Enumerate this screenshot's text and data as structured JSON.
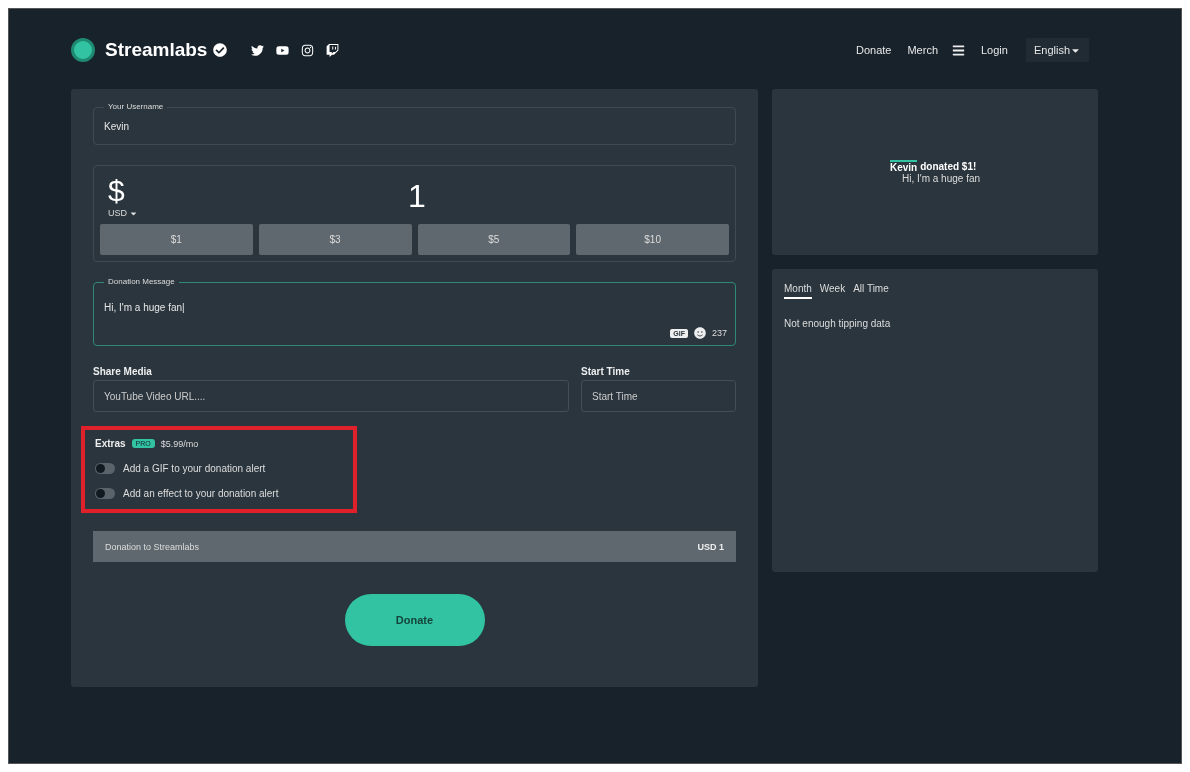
{
  "header": {
    "brand": "Streamlabs",
    "nav": [
      "Donate",
      "Merch"
    ],
    "login": "Login",
    "language": "English"
  },
  "form": {
    "username": {
      "label": "Your Username",
      "value": "Kevin"
    },
    "amount": {
      "symbol": "$",
      "currency": "USD",
      "value": "1",
      "presets": [
        "$1",
        "$3",
        "$5",
        "$10"
      ]
    },
    "message": {
      "label": "Donation Message",
      "value": "Hi, I'm a huge fan|",
      "gif": "GIF",
      "count": "237"
    },
    "media": {
      "label": "Share Media",
      "placeholder": "YouTube Video URL...."
    },
    "start": {
      "label": "Start Time",
      "placeholder": "Start Time"
    },
    "extras": {
      "label": "Extras",
      "badge": "PRO",
      "price": "$5.99/mo",
      "highlighted": true,
      "toggles": [
        {
          "label": "Add a GIF to your donation alert",
          "on": false
        },
        {
          "label": "Add an effect to your donation alert",
          "on": false
        }
      ]
    },
    "summary": {
      "label": "Donation to Streamlabs",
      "amount": "USD 1"
    },
    "submit": "Donate"
  },
  "preview": {
    "name": "Kevin",
    "action": "donated $1!",
    "message": "Hi, I'm a huge fan"
  },
  "leaderboard": {
    "tabs": [
      {
        "label": "Month",
        "selected": true
      },
      {
        "label": "Week",
        "selected": false
      },
      {
        "label": "All Time",
        "selected": false
      }
    ],
    "empty": "Not enough tipping data"
  }
}
